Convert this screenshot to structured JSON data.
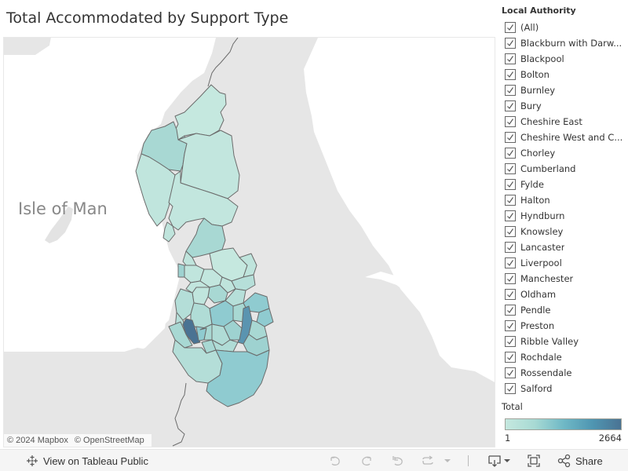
{
  "title": "Total Accommodated by Support Type",
  "map": {
    "place_label": "Isle of Man",
    "attribution": [
      "© 2024 Mapbox",
      "© OpenStreetMap"
    ],
    "colors": {
      "land": "#e6e6e6",
      "water": "#ffffff",
      "border": "#6b6b6b",
      "low": "#c5e8df",
      "mid_low": "#a8dad4",
      "mid": "#8fcbd0",
      "mid_high": "#70b9c6",
      "high": "#4a7393"
    }
  },
  "filter": {
    "title": "Local Authority",
    "items": [
      {
        "label": "(All)",
        "checked": true
      },
      {
        "label": "Blackburn with Darw...",
        "checked": true
      },
      {
        "label": "Blackpool",
        "checked": true
      },
      {
        "label": "Bolton",
        "checked": true
      },
      {
        "label": "Burnley",
        "checked": true
      },
      {
        "label": "Bury",
        "checked": true
      },
      {
        "label": "Cheshire East",
        "checked": true
      },
      {
        "label": "Cheshire West and C...",
        "checked": true
      },
      {
        "label": "Chorley",
        "checked": true
      },
      {
        "label": "Cumberland",
        "checked": true
      },
      {
        "label": "Fylde",
        "checked": true
      },
      {
        "label": "Halton",
        "checked": true
      },
      {
        "label": "Hyndburn",
        "checked": true
      },
      {
        "label": "Knowsley",
        "checked": true
      },
      {
        "label": "Lancaster",
        "checked": true
      },
      {
        "label": "Liverpool",
        "checked": true
      },
      {
        "label": "Manchester",
        "checked": true
      },
      {
        "label": "Oldham",
        "checked": true
      },
      {
        "label": "Pendle",
        "checked": true
      },
      {
        "label": "Preston",
        "checked": true
      },
      {
        "label": "Ribble Valley",
        "checked": true
      },
      {
        "label": "Rochdale",
        "checked": true
      },
      {
        "label": "Rossendale",
        "checked": true
      },
      {
        "label": "Salford",
        "checked": true
      }
    ]
  },
  "legend": {
    "title": "Total",
    "min": "1",
    "max": "2664",
    "color_start": "#c5e8df",
    "color_end": "#4a7393"
  },
  "toolbar": {
    "view_label": "View on Tableau Public",
    "share_label": "Share",
    "icons": [
      "tableau-logo-icon",
      "undo-icon",
      "redo-icon",
      "revert-icon",
      "refresh-icon",
      "dropdown-icon",
      "download-icon",
      "fullscreen-icon",
      "share-icon"
    ]
  }
}
